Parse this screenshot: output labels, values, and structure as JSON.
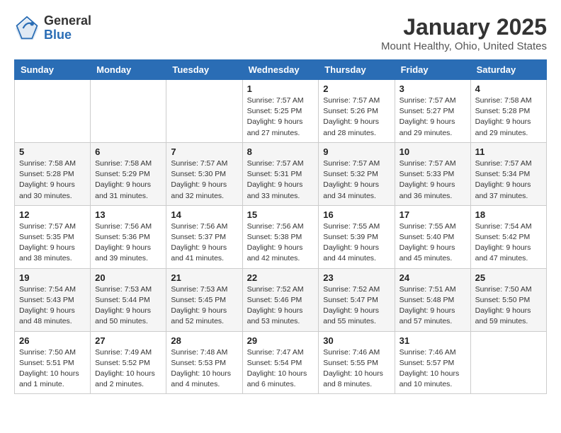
{
  "header": {
    "logo_general": "General",
    "logo_blue": "Blue",
    "title": "January 2025",
    "subtitle": "Mount Healthy, Ohio, United States"
  },
  "days_of_week": [
    "Sunday",
    "Monday",
    "Tuesday",
    "Wednesday",
    "Thursday",
    "Friday",
    "Saturday"
  ],
  "weeks": [
    [
      {
        "num": "",
        "info": ""
      },
      {
        "num": "",
        "info": ""
      },
      {
        "num": "",
        "info": ""
      },
      {
        "num": "1",
        "info": "Sunrise: 7:57 AM\nSunset: 5:25 PM\nDaylight: 9 hours and 27 minutes."
      },
      {
        "num": "2",
        "info": "Sunrise: 7:57 AM\nSunset: 5:26 PM\nDaylight: 9 hours and 28 minutes."
      },
      {
        "num": "3",
        "info": "Sunrise: 7:57 AM\nSunset: 5:27 PM\nDaylight: 9 hours and 29 minutes."
      },
      {
        "num": "4",
        "info": "Sunrise: 7:58 AM\nSunset: 5:28 PM\nDaylight: 9 hours and 29 minutes."
      }
    ],
    [
      {
        "num": "5",
        "info": "Sunrise: 7:58 AM\nSunset: 5:28 PM\nDaylight: 9 hours and 30 minutes."
      },
      {
        "num": "6",
        "info": "Sunrise: 7:58 AM\nSunset: 5:29 PM\nDaylight: 9 hours and 31 minutes."
      },
      {
        "num": "7",
        "info": "Sunrise: 7:57 AM\nSunset: 5:30 PM\nDaylight: 9 hours and 32 minutes."
      },
      {
        "num": "8",
        "info": "Sunrise: 7:57 AM\nSunset: 5:31 PM\nDaylight: 9 hours and 33 minutes."
      },
      {
        "num": "9",
        "info": "Sunrise: 7:57 AM\nSunset: 5:32 PM\nDaylight: 9 hours and 34 minutes."
      },
      {
        "num": "10",
        "info": "Sunrise: 7:57 AM\nSunset: 5:33 PM\nDaylight: 9 hours and 36 minutes."
      },
      {
        "num": "11",
        "info": "Sunrise: 7:57 AM\nSunset: 5:34 PM\nDaylight: 9 hours and 37 minutes."
      }
    ],
    [
      {
        "num": "12",
        "info": "Sunrise: 7:57 AM\nSunset: 5:35 PM\nDaylight: 9 hours and 38 minutes."
      },
      {
        "num": "13",
        "info": "Sunrise: 7:56 AM\nSunset: 5:36 PM\nDaylight: 9 hours and 39 minutes."
      },
      {
        "num": "14",
        "info": "Sunrise: 7:56 AM\nSunset: 5:37 PM\nDaylight: 9 hours and 41 minutes."
      },
      {
        "num": "15",
        "info": "Sunrise: 7:56 AM\nSunset: 5:38 PM\nDaylight: 9 hours and 42 minutes."
      },
      {
        "num": "16",
        "info": "Sunrise: 7:55 AM\nSunset: 5:39 PM\nDaylight: 9 hours and 44 minutes."
      },
      {
        "num": "17",
        "info": "Sunrise: 7:55 AM\nSunset: 5:40 PM\nDaylight: 9 hours and 45 minutes."
      },
      {
        "num": "18",
        "info": "Sunrise: 7:54 AM\nSunset: 5:42 PM\nDaylight: 9 hours and 47 minutes."
      }
    ],
    [
      {
        "num": "19",
        "info": "Sunrise: 7:54 AM\nSunset: 5:43 PM\nDaylight: 9 hours and 48 minutes."
      },
      {
        "num": "20",
        "info": "Sunrise: 7:53 AM\nSunset: 5:44 PM\nDaylight: 9 hours and 50 minutes."
      },
      {
        "num": "21",
        "info": "Sunrise: 7:53 AM\nSunset: 5:45 PM\nDaylight: 9 hours and 52 minutes."
      },
      {
        "num": "22",
        "info": "Sunrise: 7:52 AM\nSunset: 5:46 PM\nDaylight: 9 hours and 53 minutes."
      },
      {
        "num": "23",
        "info": "Sunrise: 7:52 AM\nSunset: 5:47 PM\nDaylight: 9 hours and 55 minutes."
      },
      {
        "num": "24",
        "info": "Sunrise: 7:51 AM\nSunset: 5:48 PM\nDaylight: 9 hours and 57 minutes."
      },
      {
        "num": "25",
        "info": "Sunrise: 7:50 AM\nSunset: 5:50 PM\nDaylight: 9 hours and 59 minutes."
      }
    ],
    [
      {
        "num": "26",
        "info": "Sunrise: 7:50 AM\nSunset: 5:51 PM\nDaylight: 10 hours and 1 minute."
      },
      {
        "num": "27",
        "info": "Sunrise: 7:49 AM\nSunset: 5:52 PM\nDaylight: 10 hours and 2 minutes."
      },
      {
        "num": "28",
        "info": "Sunrise: 7:48 AM\nSunset: 5:53 PM\nDaylight: 10 hours and 4 minutes."
      },
      {
        "num": "29",
        "info": "Sunrise: 7:47 AM\nSunset: 5:54 PM\nDaylight: 10 hours and 6 minutes."
      },
      {
        "num": "30",
        "info": "Sunrise: 7:46 AM\nSunset: 5:55 PM\nDaylight: 10 hours and 8 minutes."
      },
      {
        "num": "31",
        "info": "Sunrise: 7:46 AM\nSunset: 5:57 PM\nDaylight: 10 hours and 10 minutes."
      },
      {
        "num": "",
        "info": ""
      }
    ]
  ]
}
